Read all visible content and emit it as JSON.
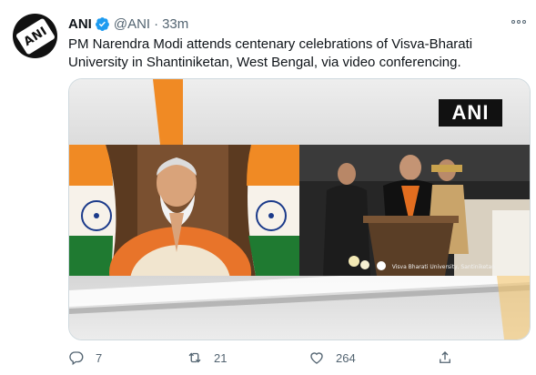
{
  "tweet": {
    "author_name": "ANI",
    "handle": "@ANI",
    "separator": "·",
    "time": "33m",
    "text": "PM Narendra Modi attends centenary celebrations of Visva-Bharati University in Shantiniketan, West Bengal, via video conferencing.",
    "avatar_text": "ANI"
  },
  "media": {
    "logo_text": "ANI",
    "caption": "Visva Bharati University, Santiniketan"
  },
  "actions": {
    "replies": "7",
    "retweets": "21",
    "likes": "264"
  },
  "colors": {
    "accent": "#1d9bf0",
    "text": "#0f1419",
    "muted": "#536471",
    "saffron": "#f08a24",
    "india_green": "#1f7a31"
  },
  "icons": [
    "verified-badge-icon",
    "more-icon",
    "reply-icon",
    "retweet-icon",
    "like-icon",
    "share-icon"
  ]
}
